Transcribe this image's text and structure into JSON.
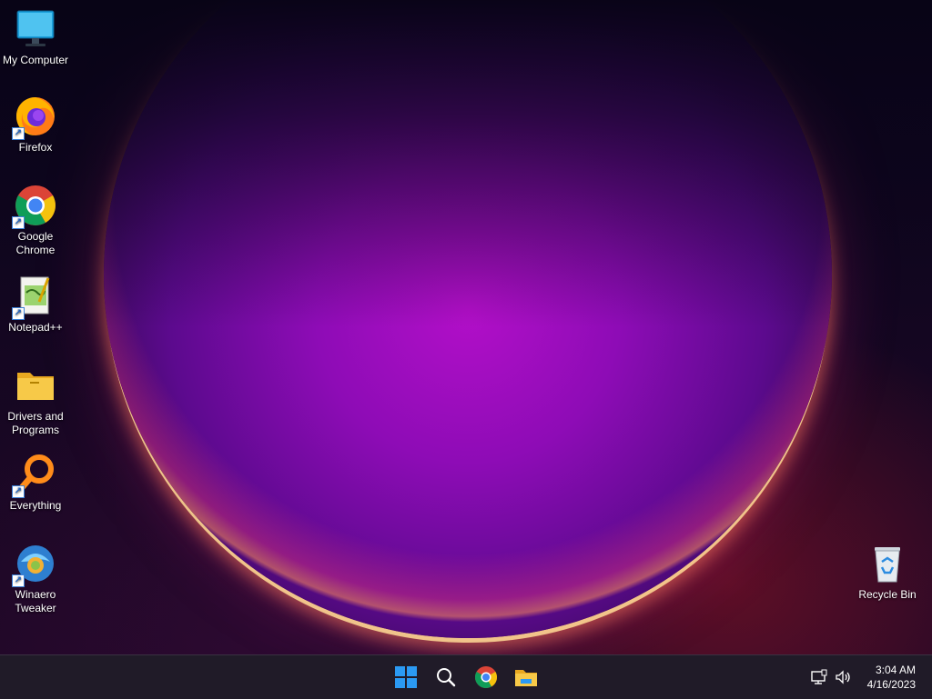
{
  "desktop": {
    "icons": [
      {
        "label": "My Computer",
        "icon": "monitor-icon"
      },
      {
        "label": "Firefox",
        "icon": "firefox-icon"
      },
      {
        "label": "Google Chrome",
        "icon": "chrome-icon"
      },
      {
        "label": "Notepad++",
        "icon": "notepadplusplus-icon"
      },
      {
        "label": "Drivers and Programs",
        "icon": "folder-icon"
      },
      {
        "label": "Everything",
        "icon": "everything-search-icon"
      },
      {
        "label": "Winaero Tweaker",
        "icon": "winaero-tweaker-icon"
      },
      {
        "label": "Recycle Bin",
        "icon": "recycle-bin-icon"
      }
    ]
  },
  "taskbar": {
    "pinned": [
      "windows-start-icon",
      "search-icon",
      "chrome-icon",
      "file-explorer-icon"
    ],
    "tray": [
      "network-icon",
      "volume-icon"
    ],
    "time": "3:04 AM",
    "date": "4/16/2023"
  },
  "colors": {
    "taskbar_bg": "#201b28",
    "start_blue": "#2b9af3",
    "folder_yellow": "#f7c948"
  }
}
